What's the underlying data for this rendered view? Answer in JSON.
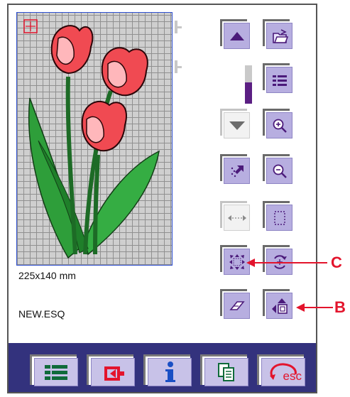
{
  "design": {
    "size_text": "225x140 mm",
    "file_name": "NEW.ESQ"
  },
  "speed_level_fraction": 0.55,
  "right_panel": {
    "buttons": [
      {
        "name": "scroll-up-button",
        "icon": "triangle-up-icon"
      },
      {
        "name": "open-file-button",
        "icon": "folder-open-icon"
      },
      {
        "name": "list-view-button",
        "icon": "list-icon"
      },
      {
        "name": "scroll-down-button",
        "icon": "triangle-down-icon",
        "disabled": true
      },
      {
        "name": "zoom-in-button",
        "icon": "zoom-in-icon"
      },
      {
        "name": "position-arrow-button",
        "icon": "corner-arrow-icon"
      },
      {
        "name": "zoom-out-button",
        "icon": "zoom-out-icon"
      },
      {
        "name": "resize-width-button",
        "icon": "resize-horizontal-icon",
        "disabled": true
      },
      {
        "name": "select-area-button",
        "icon": "dotted-rectangle-icon"
      },
      {
        "name": "move-expand-button",
        "icon": "expand-arrows-icon"
      },
      {
        "name": "rotate-button",
        "icon": "rotate-icon"
      },
      {
        "name": "erase-button",
        "icon": "eraser-icon"
      },
      {
        "name": "hoop-position-button",
        "icon": "hoop-position-icon"
      }
    ]
  },
  "bottom_bar": {
    "buttons": [
      {
        "name": "menu-list-button",
        "icon": "list-icon"
      },
      {
        "name": "stitch-out-button",
        "icon": "stitch-out-icon"
      },
      {
        "name": "info-button",
        "icon": "info-icon"
      },
      {
        "name": "copy-button",
        "icon": "copy-icon"
      },
      {
        "name": "esc-button",
        "icon": "esc-icon",
        "label": "esc"
      }
    ]
  },
  "callouts": [
    {
      "label": "C"
    },
    {
      "label": "B"
    }
  ],
  "colors": {
    "bar": "#33327d",
    "button_face": "#b7aee0",
    "icon_dark": "#4b1a7a",
    "callout": "#e3142c",
    "hoop_border": "#2e4fd0"
  }
}
